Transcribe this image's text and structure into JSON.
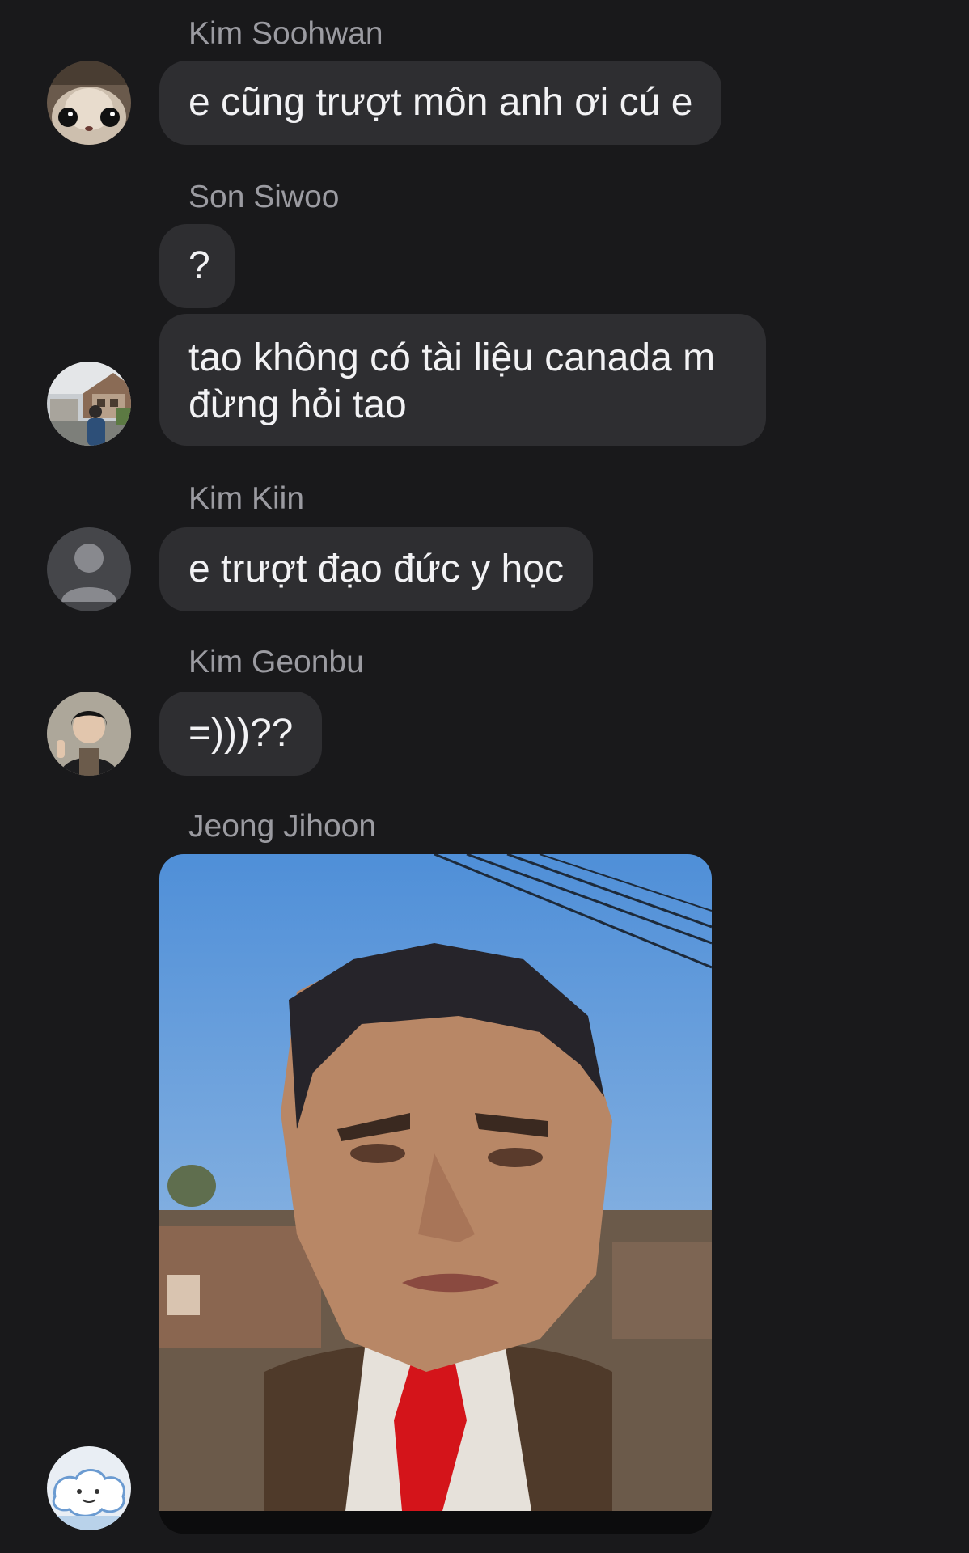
{
  "messages": [
    {
      "sender": "Kim Soohwan",
      "text": "e cũng trượt môn anh ơi cú e",
      "avatar_icon": "cat-photo-avatar-icon"
    },
    {
      "sender": "Son Siwoo",
      "text": "?"
    },
    {
      "sender": "",
      "text": "tao không có tài liệu canada m đừng hỏi tao",
      "avatar_icon": "street-photo-avatar-icon"
    },
    {
      "sender": "Kim Kiin",
      "text": "e trượt đạo đức y học",
      "avatar_icon": "default-person-avatar-icon"
    },
    {
      "sender": "Kim Geonbu",
      "text": "=)))??",
      "avatar_icon": "person-photo-avatar-icon"
    },
    {
      "sender": "Jeong Jihoon",
      "media_icon": "mr-bean-meme-image-icon",
      "avatar_icon": "cartoon-cloud-avatar-icon"
    }
  ],
  "colors": {
    "background": "#19191b",
    "bubble": "#2e2e31",
    "sender_name": "#9b9ba1",
    "message_text": "#f2f2f4"
  }
}
